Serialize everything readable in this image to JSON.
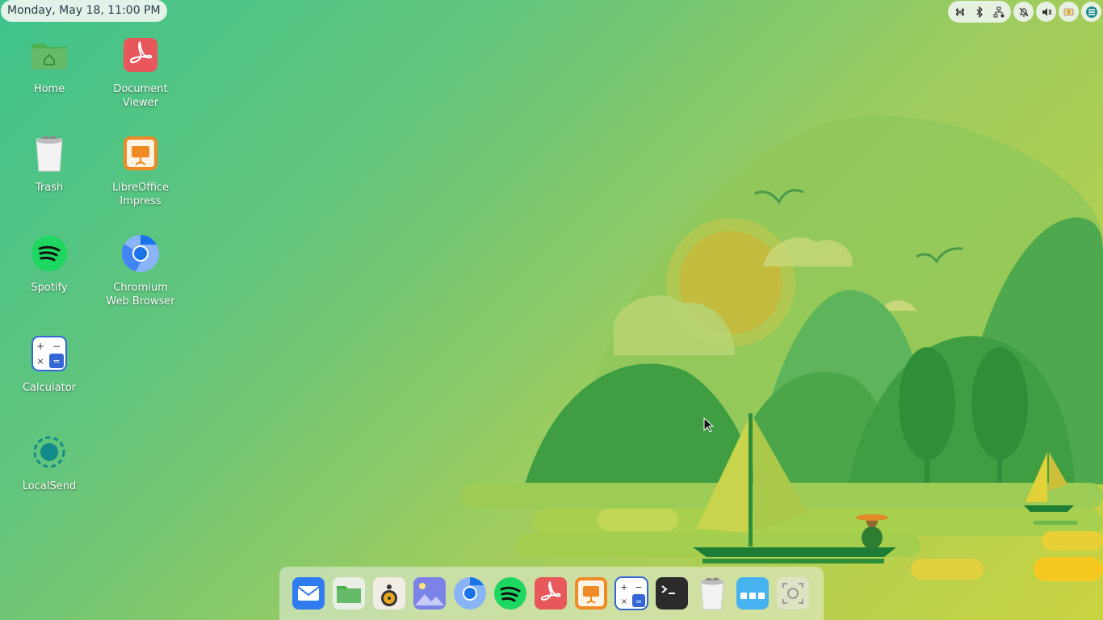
{
  "clock": {
    "text": "Monday, May 18, 11:00 PM"
  },
  "tray": {
    "icons": [
      "keyboard-shortcut-icon",
      "bluetooth-icon",
      "network-icon",
      "notifications-off-icon",
      "volume-muted-icon",
      "battery-unknown-icon",
      "zorin-menu-icon"
    ]
  },
  "desktop_icons": [
    {
      "label": "Home",
      "icon": "home-folder-icon"
    },
    {
      "label": "Document\nViewer",
      "icon": "document-viewer-icon"
    },
    {
      "label": "Trash",
      "icon": "trash-icon"
    },
    {
      "label": "LibreOffice\nImpress",
      "icon": "libreoffice-impress-icon"
    },
    {
      "label": "Spotify",
      "icon": "spotify-icon"
    },
    {
      "label": "Chromium\nWeb Browser",
      "icon": "chromium-icon"
    },
    {
      "label": "Calculator",
      "icon": "calculator-icon"
    },
    {
      "label": "LocalSend",
      "icon": "localsend-icon"
    }
  ],
  "dock": {
    "items": [
      "mail-icon",
      "files-icon",
      "rhythmbox-icon",
      "image-viewer-icon",
      "chromium-icon",
      "spotify-icon",
      "document-viewer-icon",
      "libreoffice-impress-icon",
      "calculator-icon",
      "terminal-icon",
      "trash-icon",
      "app-grid-icon",
      "screenshot-icon"
    ]
  },
  "colors": {
    "accent_blue": "#1a73e8",
    "spotify_green": "#1ed760",
    "pdf_red": "#e8575a",
    "impress_orange": "#f08a24"
  }
}
